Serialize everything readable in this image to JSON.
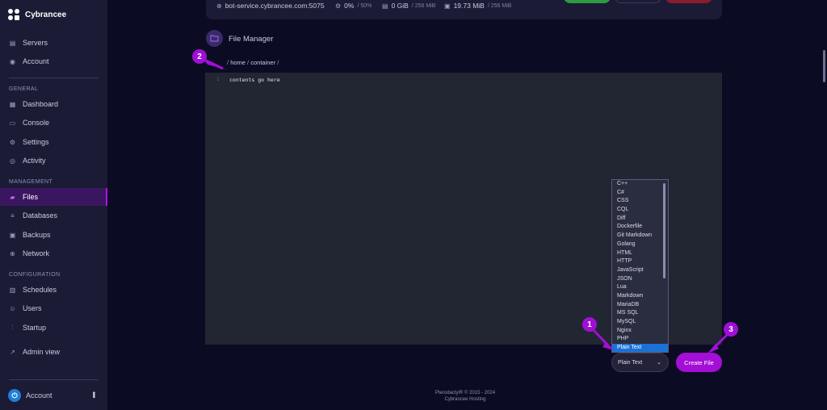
{
  "brand": {
    "name": "Cybrancee"
  },
  "sidebar": {
    "top_items": [
      {
        "label": "Servers",
        "icon": "server-icon"
      },
      {
        "label": "Account",
        "icon": "user-circle-icon"
      }
    ],
    "sections": [
      {
        "label": "GENERAL",
        "items": [
          {
            "label": "Dashboard",
            "icon": "grid-icon"
          },
          {
            "label": "Console",
            "icon": "terminal-icon"
          },
          {
            "label": "Settings",
            "icon": "gear-icon"
          },
          {
            "label": "Activity",
            "icon": "eye-icon"
          }
        ]
      },
      {
        "label": "MANAGEMENT",
        "items": [
          {
            "label": "Files",
            "icon": "folder-icon",
            "active": true
          },
          {
            "label": "Databases",
            "icon": "database-icon"
          },
          {
            "label": "Backups",
            "icon": "archive-icon"
          },
          {
            "label": "Network",
            "icon": "globe-icon"
          }
        ]
      },
      {
        "label": "CONFIGURATION",
        "items": [
          {
            "label": "Schedules",
            "icon": "calendar-icon"
          },
          {
            "label": "Users",
            "icon": "users-icon"
          },
          {
            "label": "Startup",
            "icon": "sliders-icon"
          }
        ]
      }
    ],
    "admin": {
      "label": "Admin view",
      "icon": "external-link-icon"
    },
    "account_bottom": {
      "label": "Account"
    }
  },
  "server_bar": {
    "address": "bot-service.cybrancee.com:5075",
    "cpu": "0%",
    "cpu_limit": "/ 50%",
    "memory": "0 GiB",
    "memory_limit": "/ 256 MiB",
    "disk": "19.73 MiB",
    "disk_limit": "/ 256 MiB"
  },
  "file_manager": {
    "title": "File Manager",
    "breadcrumb_sep": "/",
    "breadcrumb": [
      "home",
      "container"
    ]
  },
  "editor": {
    "line_number": "1",
    "content": "contents go here"
  },
  "language_dropdown": {
    "options": [
      "C++",
      "C#",
      "CSS",
      "CQL",
      "Diff",
      "Dockerfile",
      "Git Markdown",
      "Golang",
      "HTML",
      "HTTP",
      "JavaScript",
      "JSON",
      "Lua",
      "Markdown",
      "MariaDB",
      "MS SQL",
      "MySQL",
      "Nginx",
      "PHP",
      "Plain Text"
    ],
    "selected": "Plain Text"
  },
  "select": {
    "value": "Plain Text"
  },
  "create_button": {
    "label": "Create File"
  },
  "footer": {
    "line1": "Pterodactyl® © 2015 - 2024",
    "line2": "Cybrancee Hosting"
  },
  "annotations": [
    "1",
    "2",
    "3"
  ],
  "colors": {
    "accent": "#a30fd6",
    "active_bg": "#3b1660",
    "selection": "#1a72d6",
    "power_green": "#2e9b3f",
    "stop_red": "#8a1c2c"
  }
}
